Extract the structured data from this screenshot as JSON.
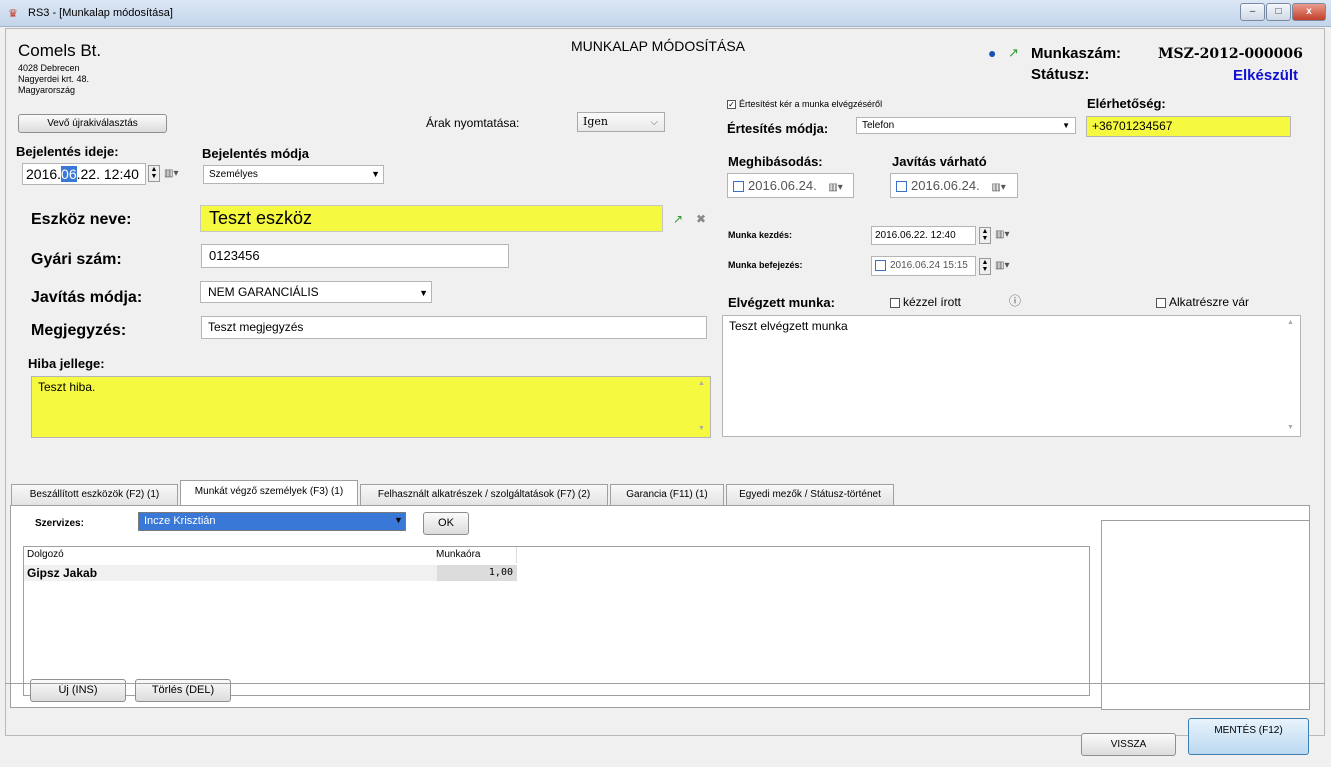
{
  "window": {
    "title": "RS3 - [Munkalap módosítása]",
    "min": "–",
    "max": "□",
    "close": "x"
  },
  "header": {
    "company": "Comels Bt.",
    "addr1": "4028 Debrecen",
    "addr2": "Nagyerdei krt. 48.",
    "addr3": "Magyarország",
    "form_title": "MUNKALAP MÓDOSÍTÁSA",
    "munkaszam_label": "Munkaszám:",
    "munkaszam_value": "MSZ-2012-000006",
    "statusz_label": "Státusz:",
    "statusz_value": "Elkészült"
  },
  "left": {
    "vevo_btn": "Vevő újrakiválasztás",
    "arak_label": "Árak nyomtatása:",
    "arak_value": "Igen",
    "bejelentes_ideje_label": "Bejelentés ideje:",
    "bej_date_pre": "2016.",
    "bej_date_sel": "06",
    "bej_date_post": ".22.  12:40",
    "bejelentes_modja_label": "Bejelentés módja",
    "bejelentes_modja_value": "Személyes",
    "eszkoz_label": "Eszköz neve:",
    "eszkoz_value": "Teszt eszköz",
    "gyari_label": "Gyári szám:",
    "gyari_value": "0123456",
    "javitas_label": "Javítás módja:",
    "javitas_value": "NEM GARANCIÁLIS",
    "megjegyzes_label": "Megjegyzés:",
    "megjegyzes_value": "Teszt megjegyzés",
    "hiba_label": "Hiba jellege:",
    "hiba_value": "Teszt hiba."
  },
  "right": {
    "ertesites_check": "Értesítést kér a munka elvégzéséről",
    "ertesites_modja_label": "Értesítés módja:",
    "ertesites_modja_value": "Telefon",
    "elerhetoseg_label": "Elérhetőség:",
    "elerhetoseg_value": "+36701234567",
    "meghibasodas_label": "Meghibásodás:",
    "meghibasodas_value": "2016.06.24.",
    "javitas_varhato_label": "Javítás várható",
    "javitas_varhato_value": "2016.06.24.",
    "munka_kezdes_label": "Munka kezdés:",
    "munka_kezdes_value": "2016.06.22.     12:40",
    "munka_befejezes_label": "Munka befejezés:",
    "munka_befejezes_value": "2016.06.24 15:15",
    "elvegzett_label": "Elvégzett munka:",
    "kezzel_irott": "kézzel írott",
    "alkatreszre_var": "Alkatrészre vár",
    "elvegzett_value": "Teszt elvégzett munka"
  },
  "tabs": [
    {
      "label": "Beszállított eszközök (F2) (1)"
    },
    {
      "label": "Munkát végző személyek (F3) (1)"
    },
    {
      "label": "Felhasznált alkatrészek / szolgáltatások (F7) (2)"
    },
    {
      "label": "Garancia (F11) (1)"
    },
    {
      "label": "Egyedi mezők / Státusz-történet"
    }
  ],
  "panel": {
    "szervizes_label": "Szervizes:",
    "szervizes_value": "Incze Krisztián",
    "ok_btn": "OK",
    "col_dolgozo": "Dolgozó",
    "col_munkaora": "Munkaóra",
    "rows": [
      {
        "name": "Gipsz Jakab",
        "hours": "1,00"
      }
    ],
    "uj_btn": "Új (INS)",
    "torles_btn": "Törlés (DEL)"
  },
  "footer": {
    "vissza_btn": "VISSZA",
    "mentes_btn": "MENTÉS (F12)"
  },
  "colors": {
    "highlight": "#f5f93f",
    "status": "#1010d0",
    "selection": "#3a78d8"
  }
}
